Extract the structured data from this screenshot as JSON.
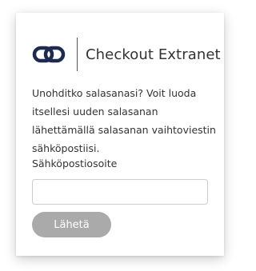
{
  "brand": {
    "name": "Checkout Extranet",
    "logo_icon": "checkout-link-logo-icon",
    "logo_color": "#1d2b52"
  },
  "reset_form": {
    "intro_text": "Unohditko salasanasi? Voit luoda itsellesi uuden salasanan lähettämällä salasanan vaihtoviestin sähköpostiisi.",
    "email_label": "Sähköpostiosoite",
    "email_value": "",
    "email_placeholder": "",
    "submit_label": "Lähetä",
    "submit_color": "#aaaaaa"
  }
}
